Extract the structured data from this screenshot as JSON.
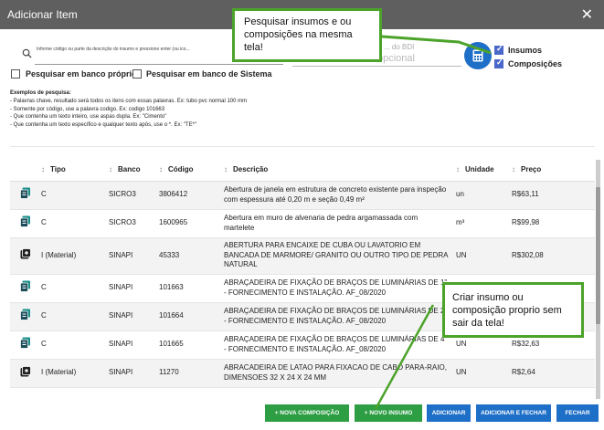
{
  "window": {
    "title": "Adicionar Item",
    "close_glyph": "✕"
  },
  "search": {
    "hint": "Informe código ou parte da descrição do insumo e pressione enter (ou ico...",
    "bdi_label": "... do BDI",
    "bdi_value": "opcional"
  },
  "filters": {
    "insumos": "Insumos",
    "composicoes": "Composições",
    "proprio": "Pesquisar em banco próprio",
    "sistema": "Pesquisar em banco de Sistema"
  },
  "examples": {
    "header": "Exemplos de pesquisa:",
    "lines": [
      "- Palavras chave, resultado será todos os itens com essas palavras. Ex: tubo pvc normal 100 mm",
      "- Somente por código, use a palavra codigo. Ex: codigo 101663",
      "- Que contenha um texto inteiro, use aspas dupla. Ex: \"Cimento\"",
      "- Que contenha um texto específico e qualquer texto após, use o *. Ex: \"TE*\""
    ]
  },
  "table": {
    "headers": {
      "tipo": "Tipo",
      "banco": "Banco",
      "codigo": "Código",
      "descricao": "Descrição",
      "unidade": "Unidade",
      "preco": "Preço"
    },
    "rows": [
      {
        "icon": "composition-icon",
        "tipo": "C",
        "banco": "SICRO3",
        "codigo": "3806412",
        "descricao": "Abertura de janela em estrutura de concreto existente para inspeção com espessura até 0,20 m e seção 0,49 m²",
        "unidade": "un",
        "preco": "R$63,11"
      },
      {
        "icon": "composition-icon",
        "tipo": "C",
        "banco": "SICRO3",
        "codigo": "1600965",
        "descricao": "Abertura em muro de alvenaria de pedra argamassada com martelete",
        "unidade": "m³",
        "preco": "R$99,98"
      },
      {
        "icon": "material-icon",
        "tipo": "I (Material)",
        "banco": "SINAPI",
        "codigo": "45333",
        "descricao": "ABERTURA PARA ENCAIXE DE CUBA OU LAVATORIO EM BANCADA DE MARMORE/ GRANITO OU OUTRO TIPO DE PEDRA NATURAL",
        "unidade": "UN",
        "preco": "R$302,08"
      },
      {
        "icon": "composition-icon",
        "tipo": "C",
        "banco": "SINAPI",
        "codigo": "101663",
        "descricao": "ABRAÇADEIRA DE FIXAÇÃO DE BRAÇOS DE LUMINÁRIAS DE 1\" - FORNECIMENTO E INSTALAÇÃO. AF_08/2020",
        "unidade": "",
        "preco": ""
      },
      {
        "icon": "composition-icon",
        "tipo": "C",
        "banco": "SINAPI",
        "codigo": "101664",
        "descricao": "ABRAÇADEIRA DE FIXAÇÃO DE BRAÇOS DE LUMINÁRIAS DE 2\" - FORNECIMENTO E INSTALAÇÃO. AF_08/2020",
        "unidade": "",
        "preco": ""
      },
      {
        "icon": "composition-icon",
        "tipo": "C",
        "banco": "SINAPI",
        "codigo": "101665",
        "descricao": "ABRAÇADEIRA DE FIXAÇÃO DE BRAÇOS DE LUMINÁRIAS DE 4\" - FORNECIMENTO E INSTALAÇÃO. AF_08/2020",
        "unidade": "UN",
        "preco": "R$32,63"
      },
      {
        "icon": "material-icon",
        "tipo": "I (Material)",
        "banco": "SINAPI",
        "codigo": "11270",
        "descricao": "ABRACADEIRA DE LATAO PARA FIXACAO DE CABO PARA-RAIO, DIMENSOES 32 X 24 X 24 MM",
        "unidade": "UN",
        "preco": "R$2,64"
      }
    ]
  },
  "buttons": {
    "nova_composicao": "+ NOVA COMPOSIÇÃO",
    "novo_insumo": "+ NOVO INSUMO",
    "adicionar": "ADICIONAR",
    "adicionar_fechar": "ADICIONAR E FECHAR",
    "fechar": "FECHAR"
  },
  "callouts": {
    "top": "Pesquisar insumos e ou composições na mesma tela!",
    "bottom": "Criar insumo ou composição proprio sem sair da tela!"
  },
  "colors": {
    "titlebar": "#5f5f5f",
    "green": "#2e9e44",
    "blue": "#1e6fc7",
    "callout_border": "#4ca32a",
    "teal_icon": "#1a8f8a"
  }
}
